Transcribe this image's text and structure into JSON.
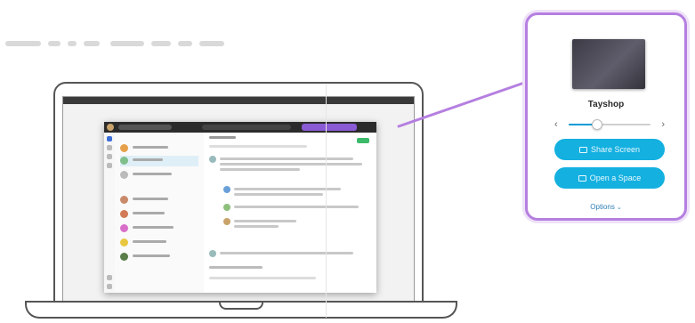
{
  "popover": {
    "device_name": "Tayshop",
    "volume": 0.35,
    "volume_min_icon": "speaker-low-icon",
    "volume_max_icon": "speaker-high-icon",
    "share_screen_label": "Share Screen",
    "open_space_label": "Open a Space",
    "options_label": "Options",
    "accent_color": "#b57fe0",
    "button_color": "#14b0e0"
  }
}
